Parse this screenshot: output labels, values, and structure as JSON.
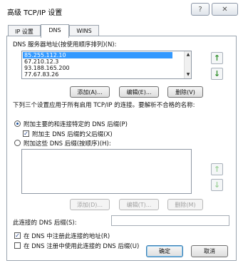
{
  "window": {
    "title": "高级 TCP/IP 设置",
    "help_icon": "?",
    "close_icon": "✕"
  },
  "tabs": [
    {
      "label": "IP 设置"
    },
    {
      "label": "DNS"
    },
    {
      "label": "WINS"
    }
  ],
  "dns": {
    "server_list_label": "DNS 服务器地址(按使用顺序排列)(N):",
    "servers": [
      "85.255.112.10",
      "67.210.12.3",
      "93.188.165.200",
      "77.67.83.26"
    ],
    "add_label": "添加(A)...",
    "edit_label": "编辑(E)...",
    "remove_label": "删除(V)",
    "description": "下列三个设置应用于所有启用 TCP/IP 的连接。要解析不合格的名称:",
    "radio_primary_label": "附加主要的和连接特定的 DNS 后缀(P)",
    "checkbox_parent_label": "附加主 DNS 后缀的父后缀(X)",
    "radio_suffixes_label": "附加这些 DNS 后缀(按顺序)(H):",
    "suffix_add_label": "添加(D)...",
    "suffix_edit_label": "编辑(T)...",
    "suffix_remove_label": "删除(M)",
    "connection_suffix_label": "此连接的 DNS 后缀(S):",
    "connection_suffix_value": "",
    "register_label": "在 DNS 中注册此连接的地址(R)",
    "use_suffix_label": "在 DNS 注册中使用此连接的 DNS 后缀(U)"
  },
  "footer": {
    "ok_label": "确定",
    "cancel_label": "取消"
  },
  "state": {
    "radio_primary": true,
    "checkbox_parent": true,
    "radio_suffixes": false,
    "register": true,
    "use_suffix": false
  },
  "icons": {
    "up": "up-arrow-icon",
    "down": "down-arrow-icon"
  }
}
